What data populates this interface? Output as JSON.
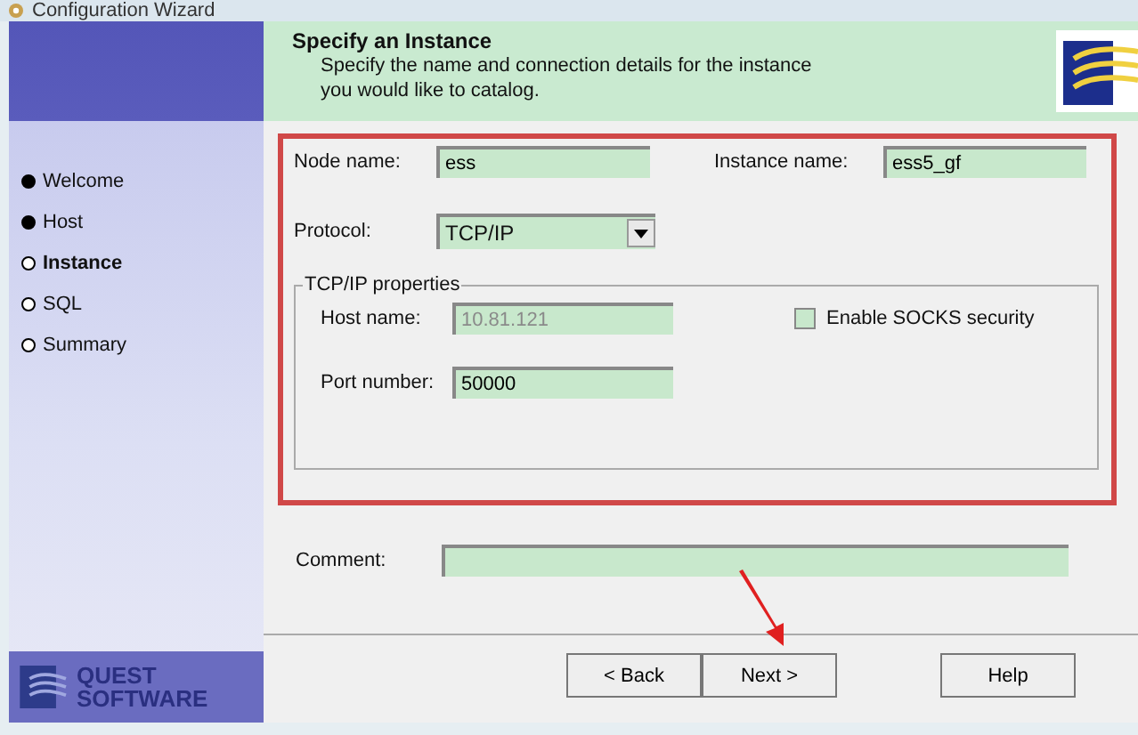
{
  "window": {
    "title": "Configuration Wizard"
  },
  "steps": [
    {
      "label": "Welcome",
      "done": true,
      "selected": false
    },
    {
      "label": "Host",
      "done": true,
      "selected": false
    },
    {
      "label": "Instance",
      "done": false,
      "selected": true
    },
    {
      "label": "SQL",
      "done": false,
      "selected": false
    },
    {
      "label": "Summary",
      "done": false,
      "selected": false
    }
  ],
  "brand": {
    "line_1": "QUEST",
    "line_2": "SOFTWARE"
  },
  "header": {
    "title": "Specify an Instance",
    "subtitle": "Specify the name and connection details for the instance you would like to catalog."
  },
  "form": {
    "node_name": {
      "label": "Node name:",
      "value": "ess"
    },
    "instance_name": {
      "label": "Instance name:",
      "value": "ess5_gf"
    },
    "protocol": {
      "label": "Protocol:",
      "value": "TCP/IP"
    },
    "group": {
      "title": "TCP/IP properties",
      "host_name": {
        "label": "Host name:",
        "value": "10.81.121",
        "disabled": true
      },
      "port_number": {
        "label": "Port number:",
        "value": "50000"
      },
      "socks": {
        "label": "Enable SOCKS security",
        "checked": false
      }
    },
    "comment": {
      "label": "Comment:"
    }
  },
  "buttons": [
    {
      "label": "< Back"
    },
    {
      "label": "Next >"
    },
    {
      "label": "Help"
    }
  ]
}
